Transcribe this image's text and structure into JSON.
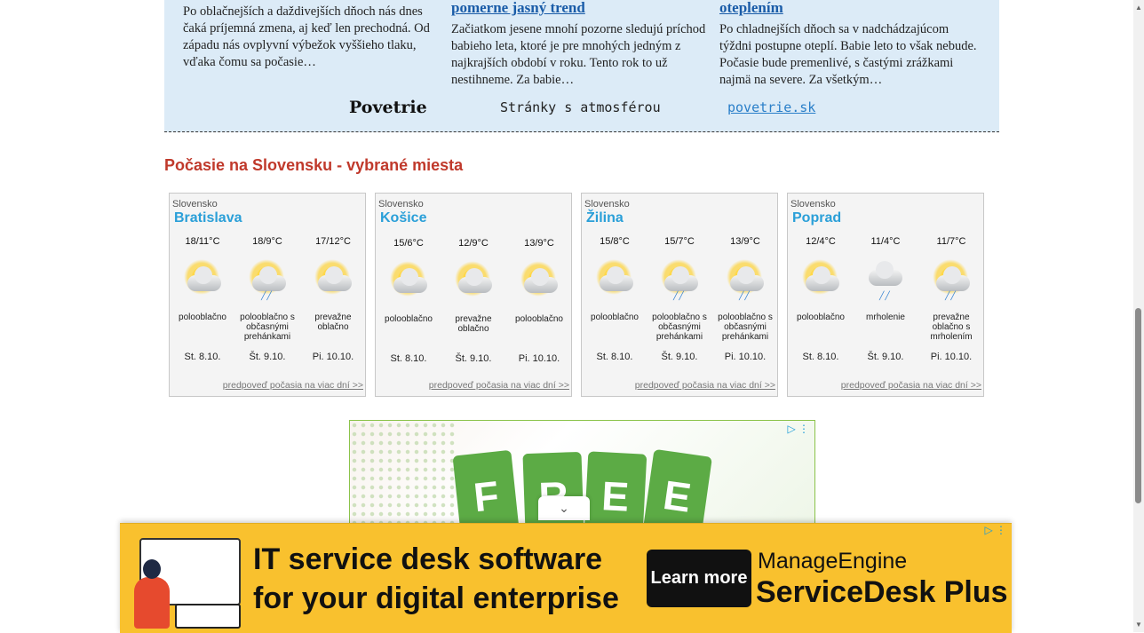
{
  "news": {
    "col1": {
      "text": "Po oblačnejších a daždivejších dňoch nás dnes čaká príjemná zmena, aj keď len prechodná. Od západu nás ovplyvní výbežok vyššieho tlaku, vďaka čomu sa počasie…"
    },
    "col2": {
      "headline": "pomerne jasný trend",
      "text": "Začiatkom jesene mnohí pozorne sledujú príchod babieho leta, ktoré je pre mnohých jedným z najkrajších období v roku. Tento rok to už nestihneme. Za babie…"
    },
    "col3": {
      "headline": "oteplením",
      "text": "Po chladnejších dňoch sa v nadchádzajúcom týždni postupne oteplí. Babie leto to však nebude. Počasie bude premenlivé, s častými zrážkami najmä na severe. Za všetkým…"
    },
    "partner": {
      "name": "Povetrie",
      "tagline": "Stránky s atmosférou",
      "link": "povetrie.sk"
    }
  },
  "section": {
    "title": "Počasie na Slovensku - vybrané miesta"
  },
  "cards": [
    {
      "region": "Slovensko",
      "city": "Bratislava",
      "more": "predpoveď počasia na viac dní >>",
      "days": [
        {
          "temp": "18/11°C",
          "desc": "polooblačno",
          "date": "St. 8.10.",
          "icon": "partly-cloudy-icon"
        },
        {
          "temp": "18/9°C",
          "desc": "polooblačno s občasnými prehánkami",
          "date": "Št. 9.10.",
          "icon": "partly-cloudy-showers-icon"
        },
        {
          "temp": "17/12°C",
          "desc": "prevažne oblačno",
          "date": "Pi. 10.10.",
          "icon": "mostly-cloudy-icon"
        }
      ]
    },
    {
      "region": "Slovensko",
      "city": "Košice",
      "more": "predpoveď počasia na viac dní >>",
      "days": [
        {
          "temp": "15/6°C",
          "desc": "polooblačno",
          "date": "St. 8.10.",
          "icon": "partly-cloudy-icon"
        },
        {
          "temp": "12/9°C",
          "desc": "prevažne oblačno",
          "date": "Št. 9.10.",
          "icon": "mostly-cloudy-icon"
        },
        {
          "temp": "13/9°C",
          "desc": "polooblačno",
          "date": "Pi. 10.10.",
          "icon": "partly-cloudy-icon"
        }
      ]
    },
    {
      "region": "Slovensko",
      "city": "Žilina",
      "more": "predpoveď počasia na viac dní >>",
      "days": [
        {
          "temp": "15/8°C",
          "desc": "polooblačno",
          "date": "St. 8.10.",
          "icon": "partly-cloudy-icon"
        },
        {
          "temp": "15/7°C",
          "desc": "polooblačno s občasnými prehánkami",
          "date": "Št. 9.10.",
          "icon": "partly-cloudy-showers-icon"
        },
        {
          "temp": "13/9°C",
          "desc": "polooblačno s občasnými prehánkami",
          "date": "Pi. 10.10.",
          "icon": "partly-cloudy-showers-icon"
        }
      ]
    },
    {
      "region": "Slovensko",
      "city": "Poprad",
      "more": "predpoveď počasia na viac dní >>",
      "days": [
        {
          "temp": "12/4°C",
          "desc": "polooblačno",
          "date": "St. 8.10.",
          "icon": "partly-cloudy-icon"
        },
        {
          "temp": "11/4°C",
          "desc": "mrholenie",
          "date": "Št. 9.10.",
          "icon": "drizzle-icon"
        },
        {
          "temp": "11/7°C",
          "desc": "prevažne oblačno s mrholením",
          "date": "Pi. 10.10.",
          "icon": "mostly-cloudy-drizzle-icon"
        }
      ]
    }
  ],
  "ad1": {
    "word": "FREE",
    "letters": [
      "F",
      "R",
      "E",
      "E"
    ]
  },
  "ad2": {
    "line1": "IT service desk software",
    "line2": "for your digital enterprise",
    "cta": "Learn more",
    "brand1": "ManageEngine",
    "brand2": "ServiceDesk Plus"
  }
}
